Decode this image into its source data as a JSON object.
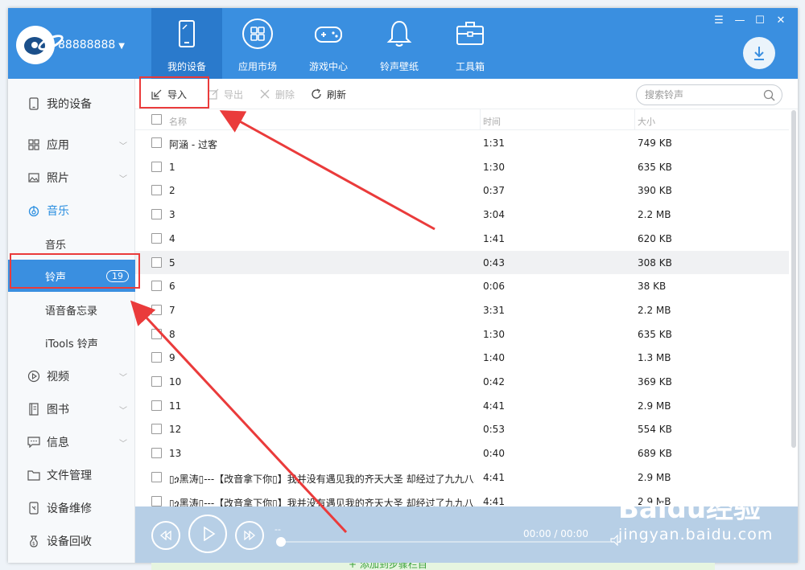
{
  "header": {
    "account": "88888888",
    "tabs": [
      {
        "label": "我的设备",
        "icon": "tablet-icon"
      },
      {
        "label": "应用市场",
        "icon": "apps-grid-icon"
      },
      {
        "label": "游戏中心",
        "icon": "gamepad-icon"
      },
      {
        "label": "铃声壁纸",
        "icon": "bell-icon"
      },
      {
        "label": "工具箱",
        "icon": "toolbox-icon"
      }
    ]
  },
  "sidebar": {
    "items": [
      {
        "label": "我的设备",
        "icon": "phone-icon"
      },
      {
        "label": "应用",
        "icon": "apps-icon"
      },
      {
        "label": "照片",
        "icon": "photo-icon"
      },
      {
        "label": "音乐",
        "icon": "music-icon"
      },
      {
        "label": "音乐"
      },
      {
        "label": "铃声",
        "badge": "19"
      },
      {
        "label": "语音备忘录"
      },
      {
        "label": "iTools 铃声"
      },
      {
        "label": "视频",
        "icon": "play-icon"
      },
      {
        "label": "图书",
        "icon": "book-icon"
      },
      {
        "label": "信息",
        "icon": "message-icon"
      },
      {
        "label": "文件管理",
        "icon": "folder-icon"
      },
      {
        "label": "设备维修",
        "icon": "repair-icon"
      },
      {
        "label": "设备回收",
        "icon": "recycle-icon"
      }
    ]
  },
  "toolbar": {
    "import": "导入",
    "export": "导出",
    "delete": "删除",
    "refresh": "刷新",
    "search_placeholder": "搜索铃声"
  },
  "table": {
    "columns": [
      "名称",
      "时间",
      "大小"
    ],
    "rows": [
      {
        "name": "阿涵 - 过客",
        "time": "1:31",
        "size": "749 KB"
      },
      {
        "name": "1",
        "time": "1:30",
        "size": "635 KB"
      },
      {
        "name": "2",
        "time": "0:37",
        "size": "390 KB"
      },
      {
        "name": "3",
        "time": "3:04",
        "size": "2.2 MB"
      },
      {
        "name": "4",
        "time": "1:41",
        "size": "620 KB"
      },
      {
        "name": "5",
        "time": "0:43",
        "size": "308 KB"
      },
      {
        "name": "6",
        "time": "0:06",
        "size": "38 KB"
      },
      {
        "name": "7",
        "time": "3:31",
        "size": "2.2 MB"
      },
      {
        "name": "8",
        "time": "1:30",
        "size": "635 KB"
      },
      {
        "name": "9",
        "time": "1:40",
        "size": "1.3 MB"
      },
      {
        "name": "10",
        "time": "0:42",
        "size": "369 KB"
      },
      {
        "name": "11",
        "time": "4:41",
        "size": "2.9 MB"
      },
      {
        "name": "12",
        "time": "0:53",
        "size": "554 KB"
      },
      {
        "name": "13",
        "time": "0:40",
        "size": "689 KB"
      },
      {
        "name": "▯ጏ黑涛▯---【改音拿下你▯】我并没有遇见我的齐天大圣 却经过了九九八...",
        "time": "4:41",
        "size": "2.9 MB"
      },
      {
        "name": "▯ጏ黑涛▯---【改音拿下你▯】我并没有遇见我的齐天大圣 却经过了九九八...",
        "time": "4:41",
        "size": "2.9 MB"
      }
    ]
  },
  "player": {
    "title": "--",
    "time": "00:00 / 00:00"
  },
  "watermark": {
    "line1": "Baidu经验",
    "line2": "jingyan.baidu.com"
  },
  "footer_hint": "+ 添加到步骤栏目"
}
